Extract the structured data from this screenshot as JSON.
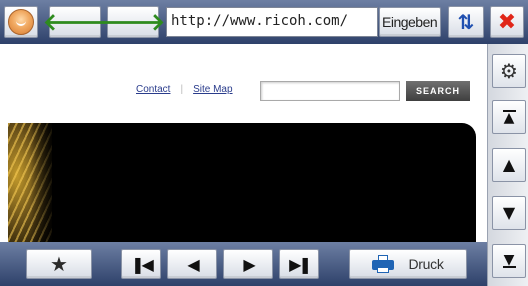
{
  "toolbar": {
    "url": "http://www.ricoh.com/",
    "enter_label": "Eingeben",
    "back_icon": "arrow-left-icon",
    "forward_icon": "arrow-right-icon",
    "reload_icon": "reload-icon",
    "close_icon": "close-icon"
  },
  "page": {
    "links": {
      "contact": "Contact",
      "sitemap": "Site Map",
      "separator": "|"
    },
    "search_placeholder": "",
    "search_button": "SEARCH"
  },
  "side_panel": {
    "settings_icon": "gear-icon",
    "scroll_top_icon": "scroll-top-icon",
    "scroll_up_icon": "scroll-up-icon",
    "scroll_down_icon": "scroll-down-icon",
    "scroll_bottom_icon": "scroll-bottom-icon"
  },
  "bottom_bar": {
    "bookmark_icon": "star-icon",
    "print_label": "Druck"
  },
  "colors": {
    "toolbar_bg": "#2e416a",
    "arrow_green": "#2e8b1e",
    "reload_blue": "#1f4fb0",
    "close_red": "#e02618"
  }
}
